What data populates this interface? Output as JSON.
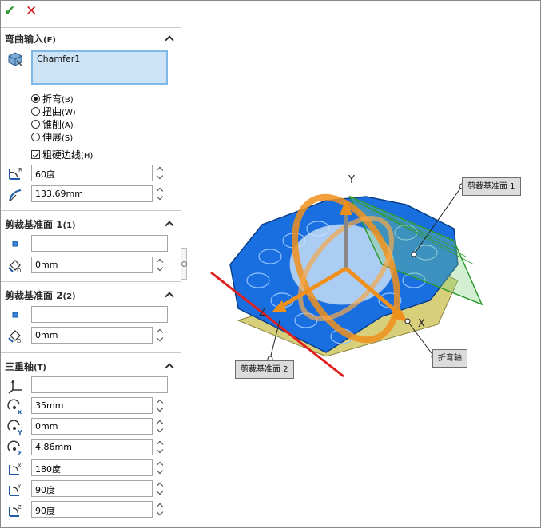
{
  "toolbar": {
    "ok_glyph": "✔",
    "cancel_glyph": "✕"
  },
  "bend_input": {
    "title": "弯曲输入",
    "hotkey": "(F)",
    "selected_body": "Chamfer1",
    "options": [
      {
        "label": "折弯",
        "hotkey": "(B)",
        "checked": true
      },
      {
        "label": "扭曲",
        "hotkey": "(W)",
        "checked": false
      },
      {
        "label": "锥削",
        "hotkey": "(A)",
        "checked": false
      },
      {
        "label": "伸展",
        "hotkey": "(S)",
        "checked": false
      }
    ],
    "hard_edges_label": "粗硬边线",
    "hard_edges_hotkey": "(H)",
    "angle": "60度",
    "radius": "133.69mm"
  },
  "trim_plane_1": {
    "title": "剪裁基准面 1",
    "hotkey": "(1)",
    "reference": "",
    "distance": "0mm"
  },
  "trim_plane_2": {
    "title": "剪裁基准面 2",
    "hotkey": "(2)",
    "reference": "",
    "distance": "0mm"
  },
  "triad": {
    "title": "三重轴",
    "hotkey": "(T)",
    "reference": "",
    "x_pos": "35mm",
    "y_pos": "0mm",
    "z_pos": "4.86mm",
    "x_rot": "180度",
    "y_rot": "90度",
    "z_rot": "90度"
  },
  "viewport": {
    "axis_x": "X",
    "axis_y": "Y",
    "axis_z": "Z",
    "callout_trim1": "剪裁基准面 1",
    "callout_trim2": "剪裁基准面 2",
    "callout_bend_axis": "折弯轴"
  },
  "colors": {
    "part_blue": "#1a6fe0",
    "triad_orange": "#f0901c",
    "trim_red": "#e02020",
    "trim_green": "#3aa23a"
  }
}
